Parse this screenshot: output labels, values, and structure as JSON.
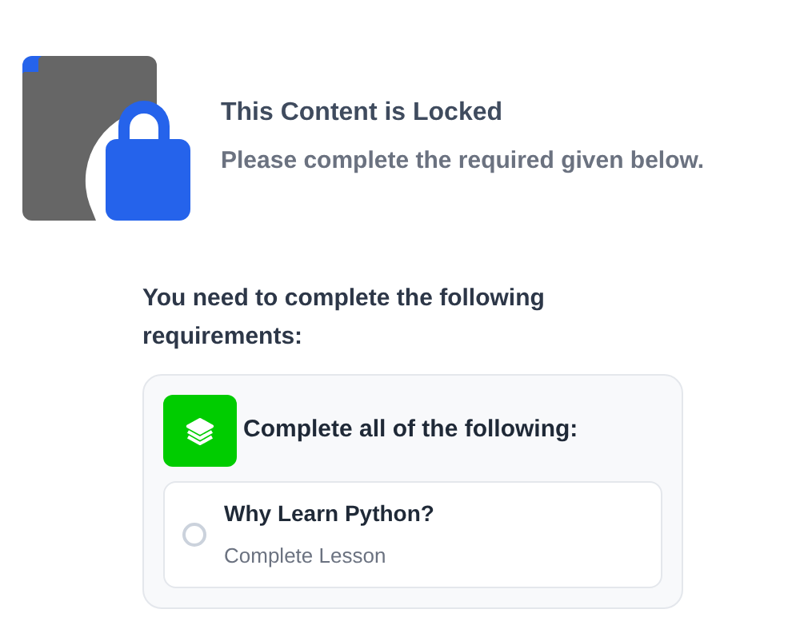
{
  "locked": {
    "title": "This Content is Locked",
    "message": "Please complete the required given below."
  },
  "requirements": {
    "heading": "You need to complete the following requirements:",
    "group_title": "Complete all of the following:",
    "items": [
      {
        "title": "Why Learn Python?",
        "subtitle": "Complete Lesson",
        "checked": false
      }
    ]
  }
}
